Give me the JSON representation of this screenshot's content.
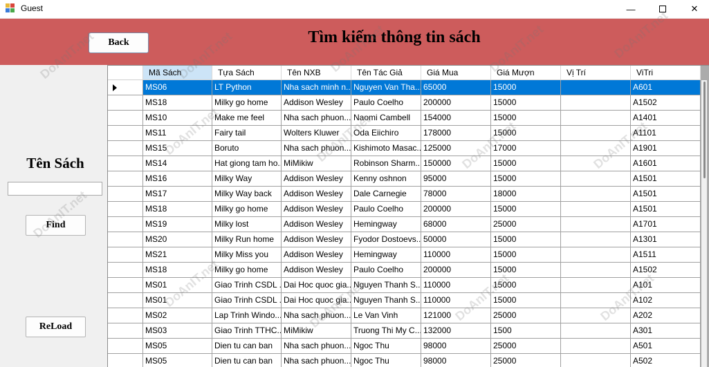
{
  "window": {
    "title": "Guest",
    "minimize_glyph": "—",
    "close_glyph": "✕"
  },
  "header": {
    "back_label": "Back",
    "title": "Tìm kiếm thông tin sách"
  },
  "sidebar": {
    "search_label": "Tên Sách",
    "search_value": "",
    "find_label": "Find",
    "reload_label": "ReLoad"
  },
  "watermark": "DoAnIT.net",
  "colors": {
    "header_band": "#cd5c5c",
    "selection": "#0078d7",
    "sorted_header": "#cce4f7"
  },
  "grid": {
    "columns": [
      "Mã Sách",
      "Tựa Sách",
      "Tên NXB",
      "Tên Tác Giả",
      "Giá Mua",
      "Giá Mượn",
      "Vị Trí",
      "ViTri"
    ],
    "selected_row": 0,
    "rows": [
      [
        "MS06",
        "LT Python",
        "Nha sach minh n...",
        "Nguyen Van Tha...",
        "65000",
        "15000",
        "",
        "A601"
      ],
      [
        "MS18",
        "Milky go home",
        "Addison Wesley",
        "Paulo Coelho",
        "200000",
        "15000",
        "",
        "A1502"
      ],
      [
        "MS10",
        "Make me feel",
        "Nha sach phuon...",
        "Naomi Cambell",
        "154000",
        "15000",
        "",
        "A1401"
      ],
      [
        "MS11",
        "Fairy tail",
        "Wolters Kluwer",
        "Oda Eiichiro",
        "178000",
        "15000",
        "",
        "A1101"
      ],
      [
        "MS15",
        "Boruto",
        "Nha sach phuon...",
        "Kishimoto Masac...",
        "125000",
        "17000",
        "",
        "A1901"
      ],
      [
        "MS14",
        "Hat giong tam ho...",
        "MiMikiw",
        "Robinson Sharm...",
        "150000",
        "15000",
        "",
        "A1601"
      ],
      [
        "MS16",
        "Milky Way",
        "Addison Wesley",
        "Kenny oshnon",
        "95000",
        "15000",
        "",
        "A1501"
      ],
      [
        "MS17",
        "Milky Way back",
        "Addison Wesley",
        "Dale Carnegie",
        "78000",
        "18000",
        "",
        "A1501"
      ],
      [
        "MS18",
        "Milky go home",
        "Addison Wesley",
        "Paulo Coelho",
        "200000",
        "15000",
        "",
        "A1501"
      ],
      [
        "MS19",
        "Milky lost",
        "Addison Wesley",
        "Hemingway",
        "68000",
        "25000",
        "",
        "A1701"
      ],
      [
        "MS20",
        "Milky Run home",
        "Addison Wesley",
        "Fyodor Dostoevs...",
        "50000",
        "15000",
        "",
        "A1301"
      ],
      [
        "MS21",
        "Milky Miss you",
        "Addison Wesley",
        "Hemingway",
        "110000",
        "15000",
        "",
        "A1511"
      ],
      [
        "MS18",
        "Milky go home",
        "Addison Wesley",
        "Paulo Coelho",
        "200000",
        "15000",
        "",
        "A1502"
      ],
      [
        "MS01",
        "Giao Trinh CSDL ...",
        "Dai Hoc quoc gia...",
        "Nguyen Thanh S...",
        "110000",
        "15000",
        "",
        "A101"
      ],
      [
        "MS01",
        "Giao Trinh CSDL ...",
        "Dai Hoc quoc gia...",
        "Nguyen Thanh S...",
        "110000",
        "15000",
        "",
        "A102"
      ],
      [
        "MS02",
        "Lap Trinh Windo...",
        "Nha sach phuon...",
        "Le Van Vinh",
        "121000",
        "25000",
        "",
        "A202"
      ],
      [
        "MS03",
        "Giao Trinh TTHC...",
        "MiMikiw",
        "Truong Thi My C...",
        "132000",
        "1500",
        "",
        "A301"
      ],
      [
        "MS05",
        "Dien tu can ban",
        "Nha sach phuon...",
        "Ngoc Thu",
        "98000",
        "25000",
        "",
        "A501"
      ],
      [
        "MS05",
        "Dien tu can ban",
        "Nha sach phuon...",
        "Ngoc Thu",
        "98000",
        "25000",
        "",
        "A502"
      ]
    ]
  }
}
